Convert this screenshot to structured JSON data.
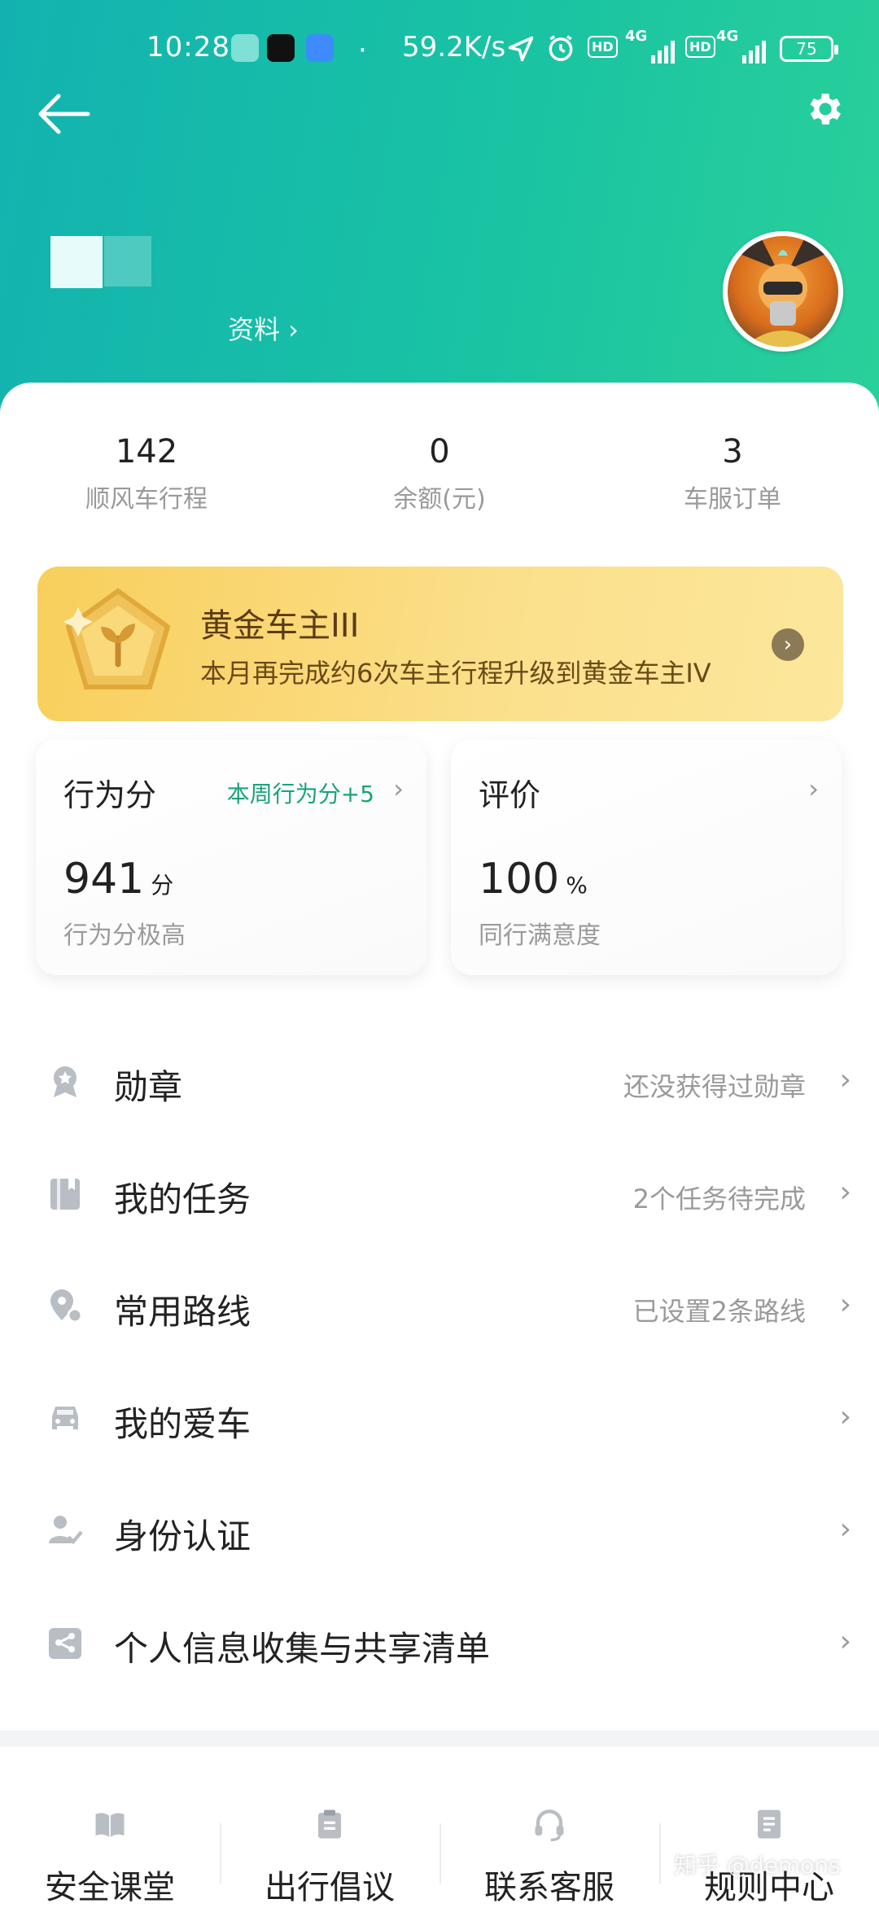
{
  "status_bar": {
    "time": "10:28",
    "network_speed": "59.2K/s",
    "hd1": "HD",
    "hd2": "HD",
    "net1": "4G",
    "net2": "4G",
    "battery": "75"
  },
  "header": {
    "profile_link": "资料 ›"
  },
  "stats": [
    {
      "value": "142",
      "label": "顺风车行程"
    },
    {
      "value": "0",
      "label": "余额(元)"
    },
    {
      "value": "3",
      "label": "车服订单"
    }
  ],
  "level_card": {
    "title": "黄金车主III",
    "subtitle": "本月再完成约6次车主行程升级到黄金车主IV",
    "go_icon": "›"
  },
  "behavior_card": {
    "title": "行为分",
    "note": "本周行为分+5",
    "value": "941",
    "unit": "分",
    "caption": "行为分极高"
  },
  "rating_card": {
    "title": "评价",
    "value": "100",
    "unit": "%",
    "caption": "同行满意度"
  },
  "menu": [
    {
      "icon": "badge-icon",
      "label": "勋章",
      "meta": "还没获得过勋章"
    },
    {
      "icon": "task-icon",
      "label": "我的任务",
      "meta": "2个任务待完成"
    },
    {
      "icon": "route-icon",
      "label": "常用路线",
      "meta": "已设置2条路线"
    },
    {
      "icon": "car-icon",
      "label": "我的爱车",
      "meta": ""
    },
    {
      "icon": "id-verify-icon",
      "label": "身份认证",
      "meta": ""
    },
    {
      "icon": "share-list-icon",
      "label": "个人信息收集与共享清单",
      "meta": ""
    }
  ],
  "bottom_tabs": [
    {
      "icon": "book-icon",
      "label": "安全课堂"
    },
    {
      "icon": "clipboard-icon",
      "label": "出行倡议"
    },
    {
      "icon": "headset-icon",
      "label": "联系客服"
    },
    {
      "icon": "document-icon",
      "label": "规则中心"
    }
  ],
  "watermark": "知乎 @demons",
  "colors": {
    "header_start": "#13b2b0",
    "header_end": "#2ad09a",
    "accent_green": "#1aa37a",
    "gold": "#f8cf5c"
  }
}
